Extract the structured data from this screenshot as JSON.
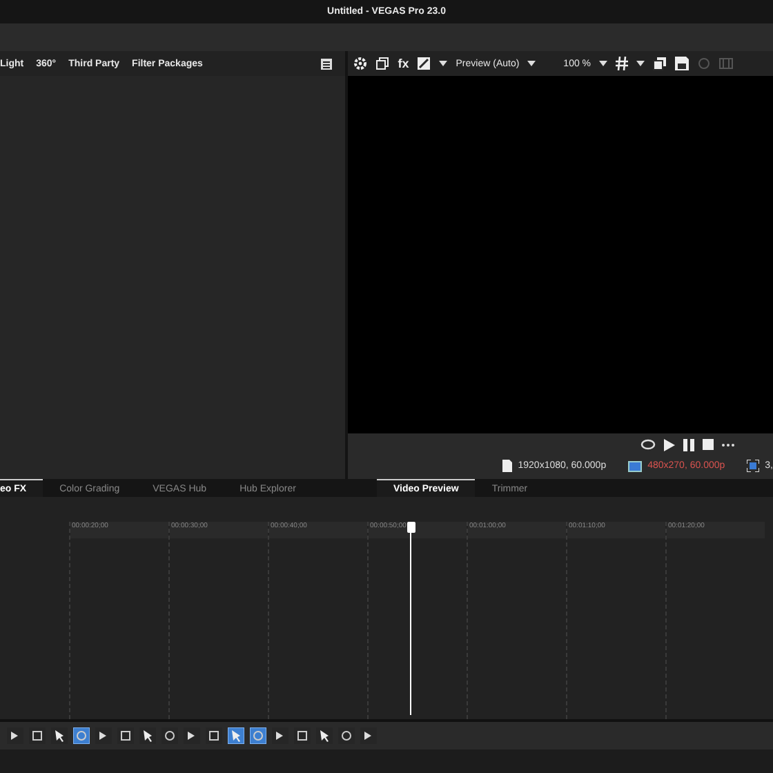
{
  "window": {
    "title": "Untitled - VEGAS Pro 23.0"
  },
  "fx_panel": {
    "tabs": [
      {
        "label": "Light"
      },
      {
        "label": "360°"
      },
      {
        "label": "Third Party"
      },
      {
        "label": "Filter Packages"
      }
    ]
  },
  "preview_toolbar": {
    "fx_label": "fx",
    "quality": "Preview (Auto)",
    "zoom": "100 %"
  },
  "preview_status": {
    "project": "1920x1080, 60.000p",
    "preview": "480x270, 60.000p",
    "display": "3,"
  },
  "left_tabs": [
    {
      "label": "eo FX",
      "selected": true
    },
    {
      "label": "Color Grading",
      "selected": false
    },
    {
      "label": "VEGAS Hub",
      "selected": false
    },
    {
      "label": "Hub Explorer",
      "selected": false
    }
  ],
  "right_tabs": [
    {
      "label": "Video Preview",
      "selected": true
    },
    {
      "label": "Trimmer",
      "selected": false
    }
  ],
  "timeline": {
    "ruler": [
      "00:00:20;00",
      "00:00:30;00",
      "00:00:40;00",
      "00:00:50;00",
      "00:01:00;00",
      "00:01:10;00",
      "00:01:20;00"
    ]
  },
  "edit_toolbar": {
    "tools": [
      {
        "selected": false
      },
      {
        "selected": false
      },
      {
        "selected": false
      },
      {
        "selected": true
      },
      {
        "selected": false
      },
      {
        "selected": false
      },
      {
        "selected": false
      },
      {
        "selected": false
      },
      {
        "selected": false
      },
      {
        "selected": false
      },
      {
        "selected": true
      },
      {
        "selected": true
      },
      {
        "selected": false
      },
      {
        "selected": false
      },
      {
        "selected": false
      },
      {
        "selected": false
      },
      {
        "selected": false
      }
    ]
  }
}
